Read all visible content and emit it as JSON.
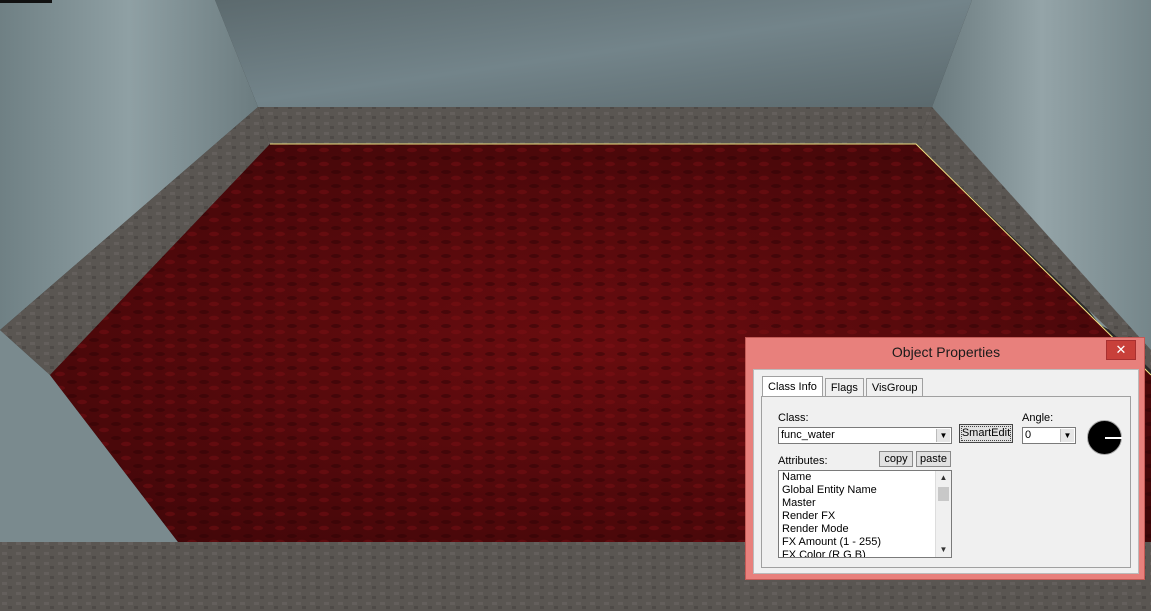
{
  "scene": {
    "colors": {
      "wall": "#7f9094",
      "wall_dark": "#5c6a6e",
      "border": "#55514d",
      "floor": "#5a0a0c",
      "floor_dark": "#3a0507",
      "ground": "#5f5b57",
      "selection": "#f0e080"
    }
  },
  "dialog": {
    "title": "Object Properties",
    "close_glyph": "✕",
    "tabs": [
      "Class Info",
      "Flags",
      "VisGroup"
    ],
    "class_label": "Class:",
    "class_value": "func_water",
    "smartedit_label": "SmartEdit",
    "angle_label": "Angle:",
    "angle_value": "0",
    "attributes_label": "Attributes:",
    "copy_label": "copy",
    "paste_label": "paste",
    "attributes": [
      "Name",
      "Global Entity Name",
      "Master",
      "Render FX",
      "Render Mode",
      "FX Amount (1 - 255)",
      "FX Color (R G B)"
    ],
    "dropdown_glyph": "▼",
    "scroll_up_glyph": "▲",
    "scroll_down_glyph": "▼"
  }
}
